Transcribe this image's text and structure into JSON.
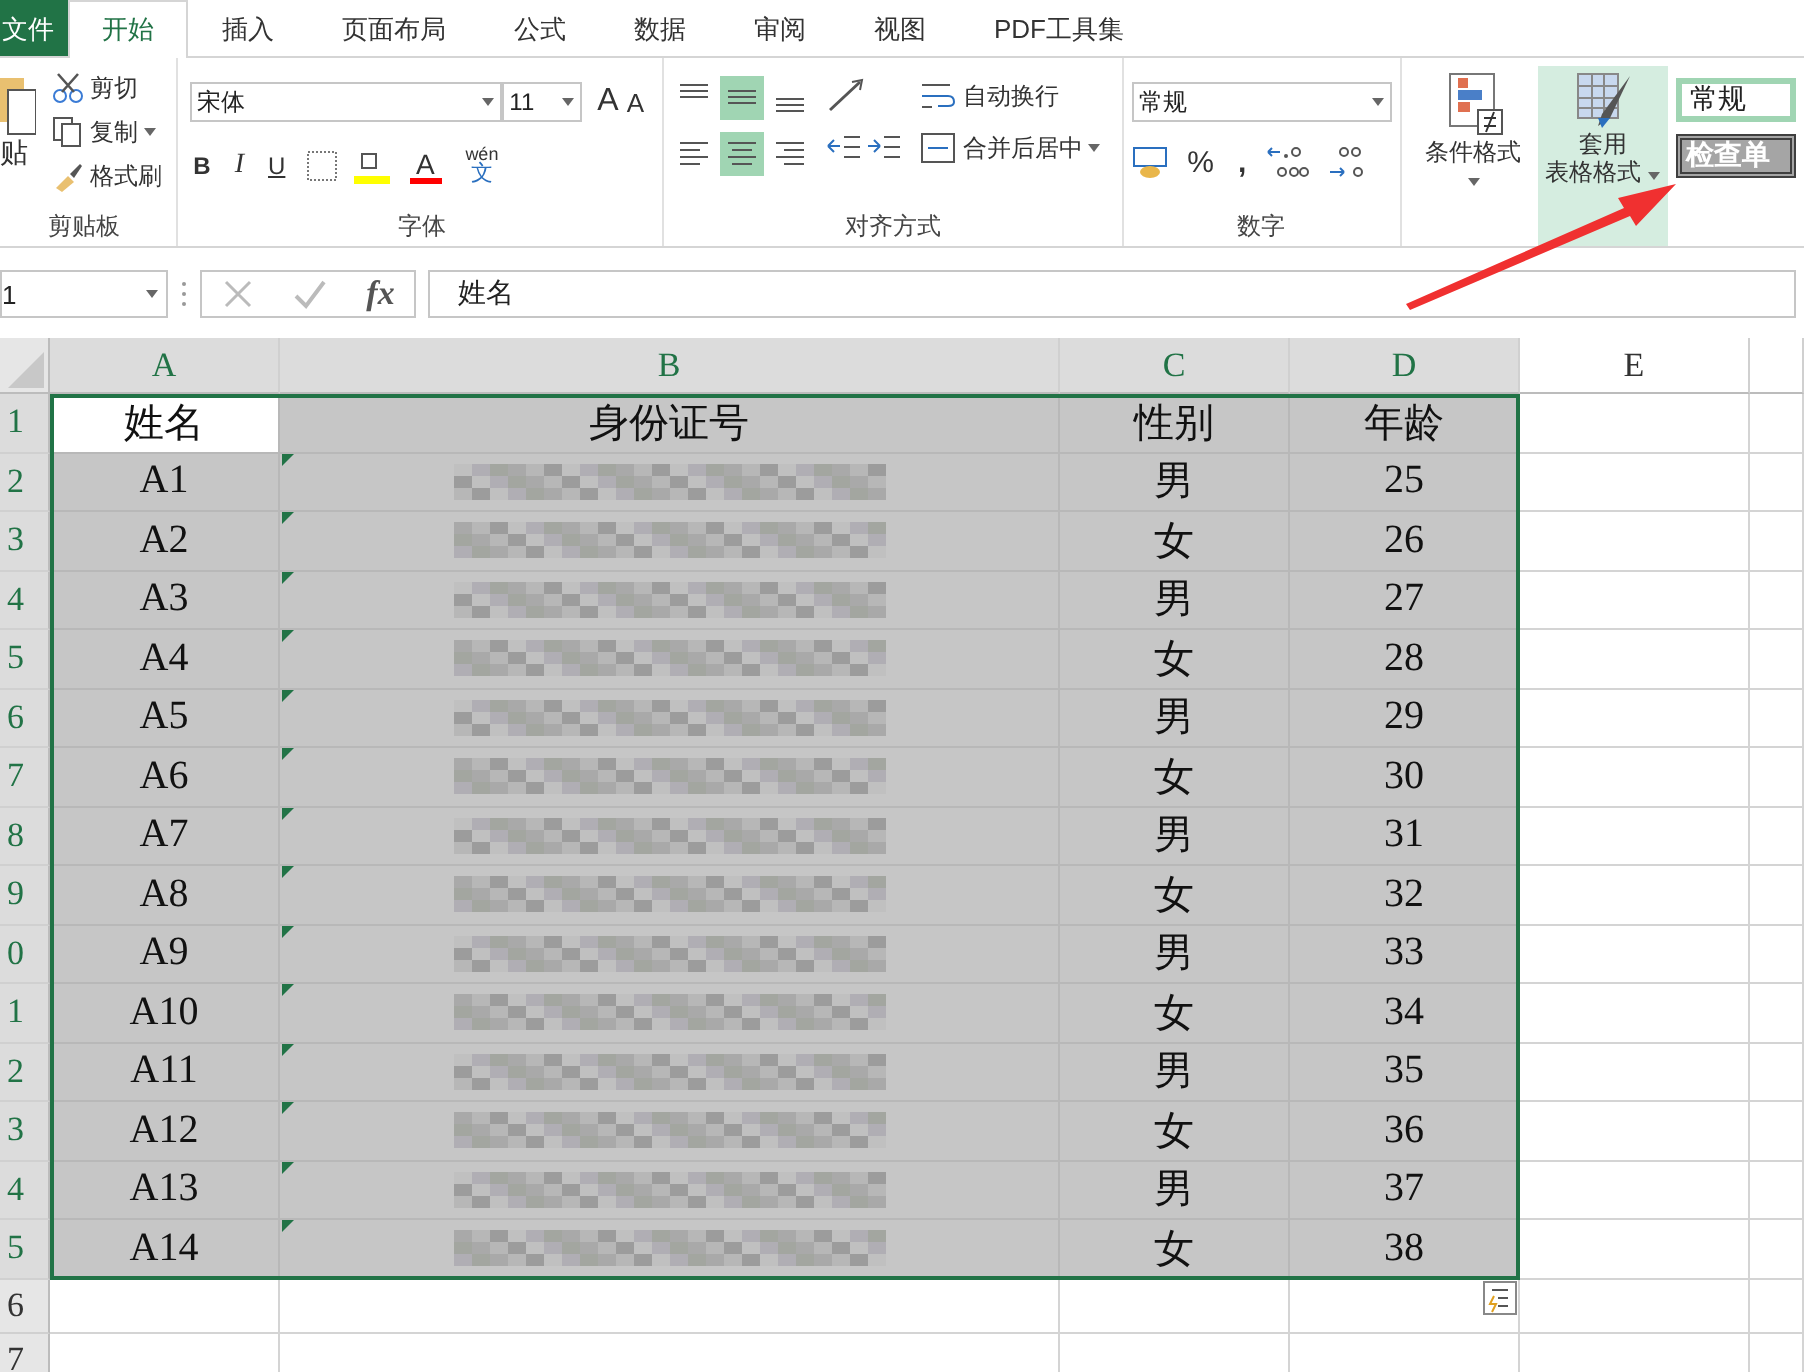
{
  "tabs": [
    {
      "label": "文件",
      "kind": "file",
      "selected": false
    },
    {
      "label": "开始",
      "kind": "tab",
      "selected": true
    },
    {
      "label": "插入",
      "kind": "tab",
      "selected": false
    },
    {
      "label": "页面布局",
      "kind": "tab",
      "selected": false
    },
    {
      "label": "公式",
      "kind": "tab",
      "selected": false
    },
    {
      "label": "数据",
      "kind": "tab",
      "selected": false
    },
    {
      "label": "审阅",
      "kind": "tab",
      "selected": false
    },
    {
      "label": "视图",
      "kind": "tab",
      "selected": false
    },
    {
      "label": "PDF工具集",
      "kind": "tab",
      "selected": false
    }
  ],
  "clipboard": {
    "paste": "贴",
    "cut": "剪切",
    "copy": "复制",
    "painter": "格式刷",
    "group": "剪贴板"
  },
  "font": {
    "name": "宋体",
    "size": "11",
    "grow": "A",
    "shrink": "A",
    "bold": "B",
    "italic": "I",
    "underline": "U",
    "font_color": "A",
    "phonetic_top": "wén",
    "phonetic_bottom": "文",
    "group": "字体"
  },
  "alignment": {
    "vertical": [
      {
        "selected": false
      },
      {
        "selected": true
      },
      {
        "selected": false
      }
    ],
    "horizontal": [
      {
        "selected": false
      },
      {
        "selected": true
      },
      {
        "selected": false
      }
    ],
    "wrap": "自动换行",
    "merge": "合并后居中",
    "group": "对齐方式"
  },
  "number": {
    "format": "常规",
    "percent": "%",
    "comma": ",",
    "group": "数字"
  },
  "styles": {
    "conditional": "条件格式",
    "table_format_top": "套用",
    "table_format_bottom": "表格格式",
    "table_format_selected": true,
    "gallery": [
      "常规",
      "检查单"
    ]
  },
  "formula_bar": {
    "name_box": "1",
    "fx": "fx",
    "formula": "姓名"
  },
  "columns": [
    {
      "label": "A",
      "selected": true
    },
    {
      "label": "B",
      "selected": true
    },
    {
      "label": "C",
      "selected": true
    },
    {
      "label": "D",
      "selected": true
    },
    {
      "label": "E",
      "selected": false
    }
  ],
  "rows": [
    {
      "header": "1",
      "selected": true,
      "cells": [
        {
          "kind": "text",
          "text": "姓名",
          "active": true
        },
        {
          "kind": "text",
          "text": "身份证号"
        },
        {
          "kind": "text",
          "text": "性别"
        },
        {
          "kind": "text",
          "text": "年龄"
        }
      ]
    },
    {
      "header": "2",
      "selected": true,
      "cells": [
        {
          "kind": "text",
          "text": "A1"
        },
        {
          "kind": "redacted",
          "flagged": true
        },
        {
          "kind": "text",
          "text": "男"
        },
        {
          "kind": "text",
          "text": "25"
        }
      ]
    },
    {
      "header": "3",
      "selected": true,
      "cells": [
        {
          "kind": "text",
          "text": "A2"
        },
        {
          "kind": "redacted",
          "flagged": true
        },
        {
          "kind": "text",
          "text": "女"
        },
        {
          "kind": "text",
          "text": "26"
        }
      ]
    },
    {
      "header": "4",
      "selected": true,
      "cells": [
        {
          "kind": "text",
          "text": "A3"
        },
        {
          "kind": "redacted",
          "flagged": true
        },
        {
          "kind": "text",
          "text": "男"
        },
        {
          "kind": "text",
          "text": "27"
        }
      ]
    },
    {
      "header": "5",
      "selected": true,
      "cells": [
        {
          "kind": "text",
          "text": "A4"
        },
        {
          "kind": "redacted",
          "flagged": true
        },
        {
          "kind": "text",
          "text": "女"
        },
        {
          "kind": "text",
          "text": "28"
        }
      ]
    },
    {
      "header": "6",
      "selected": true,
      "cells": [
        {
          "kind": "text",
          "text": "A5"
        },
        {
          "kind": "redacted",
          "flagged": true
        },
        {
          "kind": "text",
          "text": "男"
        },
        {
          "kind": "text",
          "text": "29"
        }
      ]
    },
    {
      "header": "7",
      "selected": true,
      "cells": [
        {
          "kind": "text",
          "text": "A6"
        },
        {
          "kind": "redacted",
          "flagged": true
        },
        {
          "kind": "text",
          "text": "女"
        },
        {
          "kind": "text",
          "text": "30"
        }
      ]
    },
    {
      "header": "8",
      "selected": true,
      "cells": [
        {
          "kind": "text",
          "text": "A7"
        },
        {
          "kind": "redacted",
          "flagged": true
        },
        {
          "kind": "text",
          "text": "男"
        },
        {
          "kind": "text",
          "text": "31"
        }
      ]
    },
    {
      "header": "9",
      "selected": true,
      "cells": [
        {
          "kind": "text",
          "text": "A8"
        },
        {
          "kind": "redacted",
          "flagged": true
        },
        {
          "kind": "text",
          "text": "女"
        },
        {
          "kind": "text",
          "text": "32"
        }
      ]
    },
    {
      "header": "0",
      "selected": true,
      "cells": [
        {
          "kind": "text",
          "text": "A9"
        },
        {
          "kind": "redacted",
          "flagged": true
        },
        {
          "kind": "text",
          "text": "男"
        },
        {
          "kind": "text",
          "text": "33"
        }
      ]
    },
    {
      "header": "1",
      "selected": true,
      "cells": [
        {
          "kind": "text",
          "text": "A10"
        },
        {
          "kind": "redacted",
          "flagged": true
        },
        {
          "kind": "text",
          "text": "女"
        },
        {
          "kind": "text",
          "text": "34"
        }
      ]
    },
    {
      "header": "2",
      "selected": true,
      "cells": [
        {
          "kind": "text",
          "text": "A11"
        },
        {
          "kind": "redacted",
          "flagged": true
        },
        {
          "kind": "text",
          "text": "男"
        },
        {
          "kind": "text",
          "text": "35"
        }
      ]
    },
    {
      "header": "3",
      "selected": true,
      "cells": [
        {
          "kind": "text",
          "text": "A12"
        },
        {
          "kind": "redacted",
          "flagged": true
        },
        {
          "kind": "text",
          "text": "女"
        },
        {
          "kind": "text",
          "text": "36"
        }
      ]
    },
    {
      "header": "4",
      "selected": true,
      "cells": [
        {
          "kind": "text",
          "text": "A13"
        },
        {
          "kind": "redacted",
          "flagged": true
        },
        {
          "kind": "text",
          "text": "男"
        },
        {
          "kind": "text",
          "text": "37"
        }
      ]
    },
    {
      "header": "5",
      "selected": true,
      "cells": [
        {
          "kind": "text",
          "text": "A14"
        },
        {
          "kind": "redacted",
          "flagged": true
        },
        {
          "kind": "text",
          "text": "女"
        },
        {
          "kind": "text",
          "text": "38"
        }
      ]
    },
    {
      "header": "6",
      "selected": false,
      "cells": []
    },
    {
      "header": "7",
      "selected": false,
      "cells": []
    }
  ]
}
